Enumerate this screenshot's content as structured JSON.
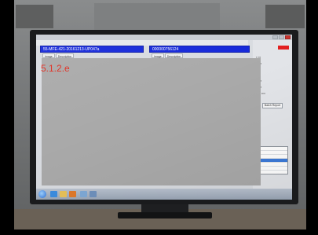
{
  "monitor": {
    "window": {
      "left_id": "55-MFE-421-20161213-UP047a",
      "right_id": "000000756124",
      "mini_tabs": [
        "Image",
        "Description"
      ]
    },
    "redaction": {
      "label": "5.1.2.e",
      "label_color": "#e02b1f",
      "fill_color": "#a9a9a9"
    },
    "side_panel": {
      "button_label": "Batch Report",
      "status_color": "#e21d1d"
    },
    "colors": {
      "title_bar": "#1326d9",
      "taskbar": "#9aa6b6"
    },
    "taskbar_icons": [
      "windows-start-icon",
      "ie-icon",
      "folder-icon",
      "media-icon",
      "app-icon",
      "app-icon"
    ]
  }
}
